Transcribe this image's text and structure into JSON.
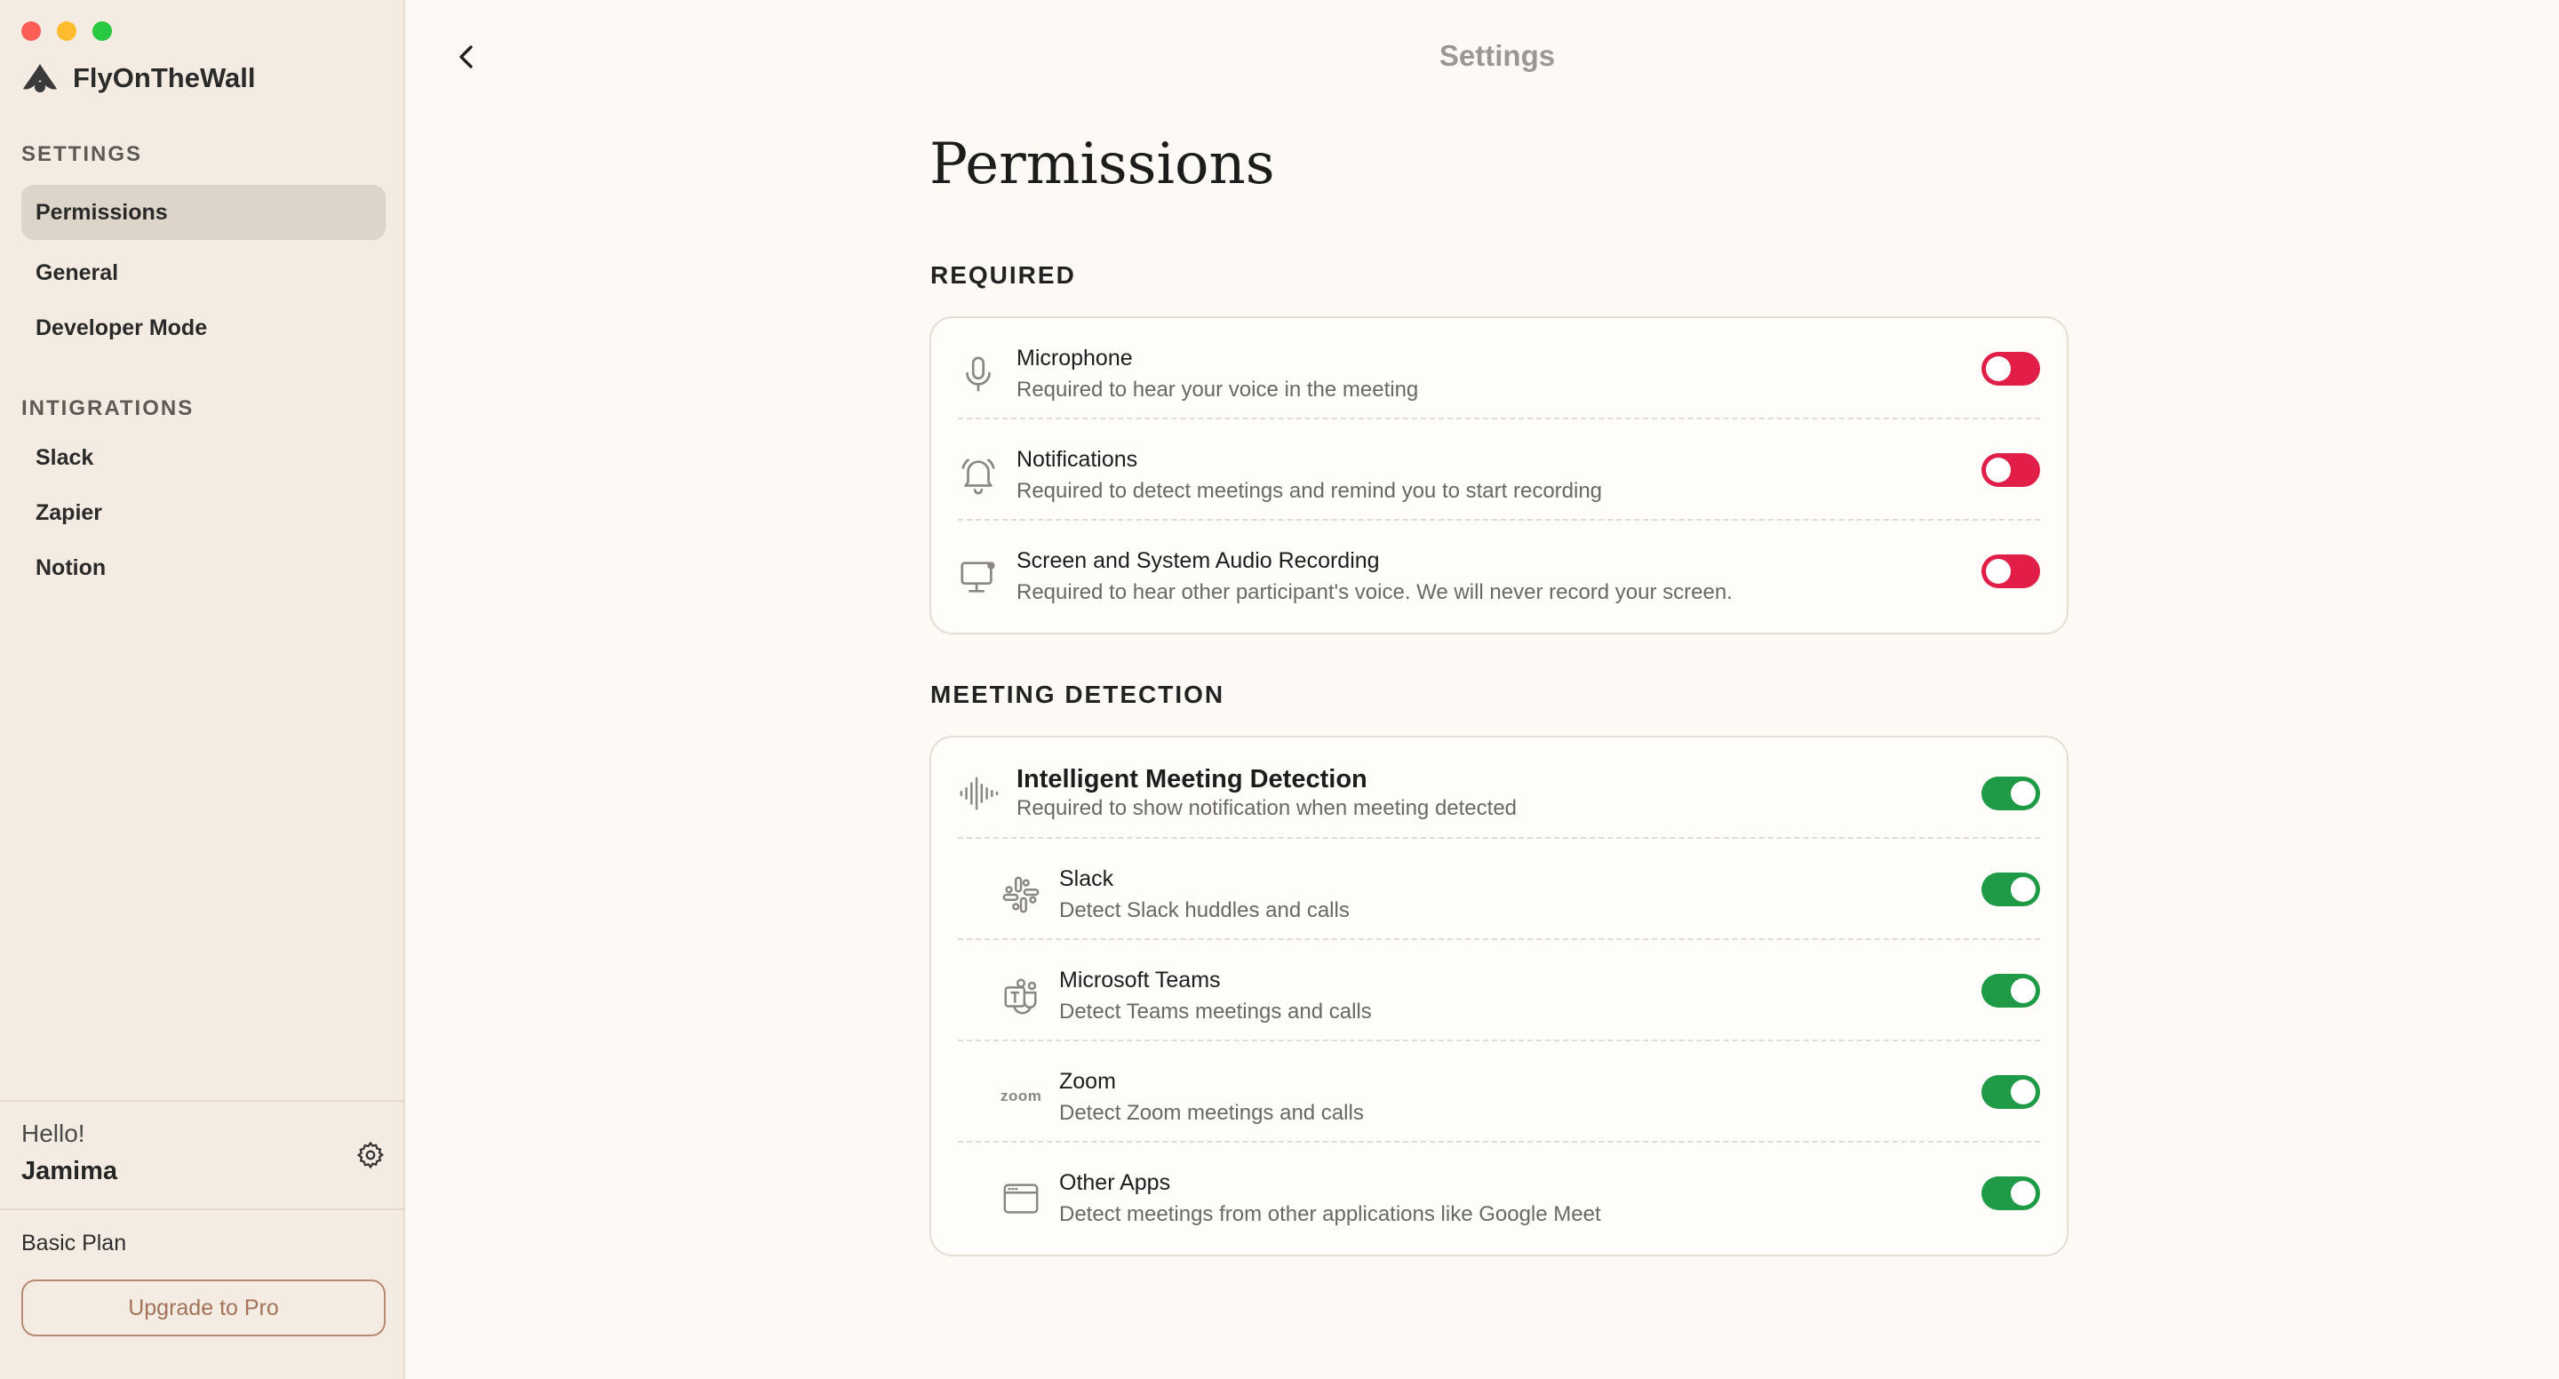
{
  "app": {
    "name": "FlyOnTheWall",
    "window_title": "Settings"
  },
  "sidebar": {
    "settings_label": "SETTINGS",
    "settings_items": [
      {
        "label": "Permissions",
        "active": true
      },
      {
        "label": "General"
      },
      {
        "label": "Developer Mode"
      }
    ],
    "integrations_label": "INTIGRATIONS",
    "integration_items": [
      {
        "label": "Slack"
      },
      {
        "label": "Zapier"
      },
      {
        "label": "Notion"
      }
    ],
    "greeting": "Hello!",
    "user_name": "Jamima",
    "plan": "Basic Plan",
    "upgrade_label": "Upgrade to Pro"
  },
  "main": {
    "page_title": "Permissions",
    "required": {
      "label": "REQUIRED",
      "items": [
        {
          "title": "Microphone",
          "desc": "Required to hear your voice in the meeting",
          "icon": "microphone-icon",
          "enabled": false
        },
        {
          "title": "Notifications",
          "desc": "Required to detect meetings and remind you to start recording",
          "icon": "bell-icon",
          "enabled": false
        },
        {
          "title": "Screen and System Audio Recording",
          "desc": "Required to hear other participant's voice. We will never record your screen.",
          "icon": "monitor-icon",
          "enabled": false
        }
      ]
    },
    "meeting_detection": {
      "label": "MEETING DETECTION",
      "items": [
        {
          "title": "Intelligent Meeting Detection",
          "desc": "Required to show notification when meeting detected",
          "icon": "waveform-icon",
          "enabled": true
        },
        {
          "title": "Slack",
          "desc": "Detect Slack huddles and calls",
          "icon": "slack-icon",
          "enabled": true
        },
        {
          "title": "Microsoft Teams",
          "desc": "Detect Teams meetings and calls",
          "icon": "teams-icon",
          "enabled": true
        },
        {
          "title": "Zoom",
          "desc": "Detect Zoom meetings and calls",
          "icon": "zoom-icon",
          "icon_text": "zoom",
          "enabled": true
        },
        {
          "title": "Other Apps",
          "desc": "Detect meetings from other applications like Google Meet",
          "icon": "app-window-icon",
          "enabled": true
        }
      ]
    }
  },
  "colors": {
    "toggle_off": "#e01e48",
    "toggle_on": "#1f9a47",
    "sidebar_bg": "#f4ece2",
    "accent_brown": "#a3735a"
  }
}
